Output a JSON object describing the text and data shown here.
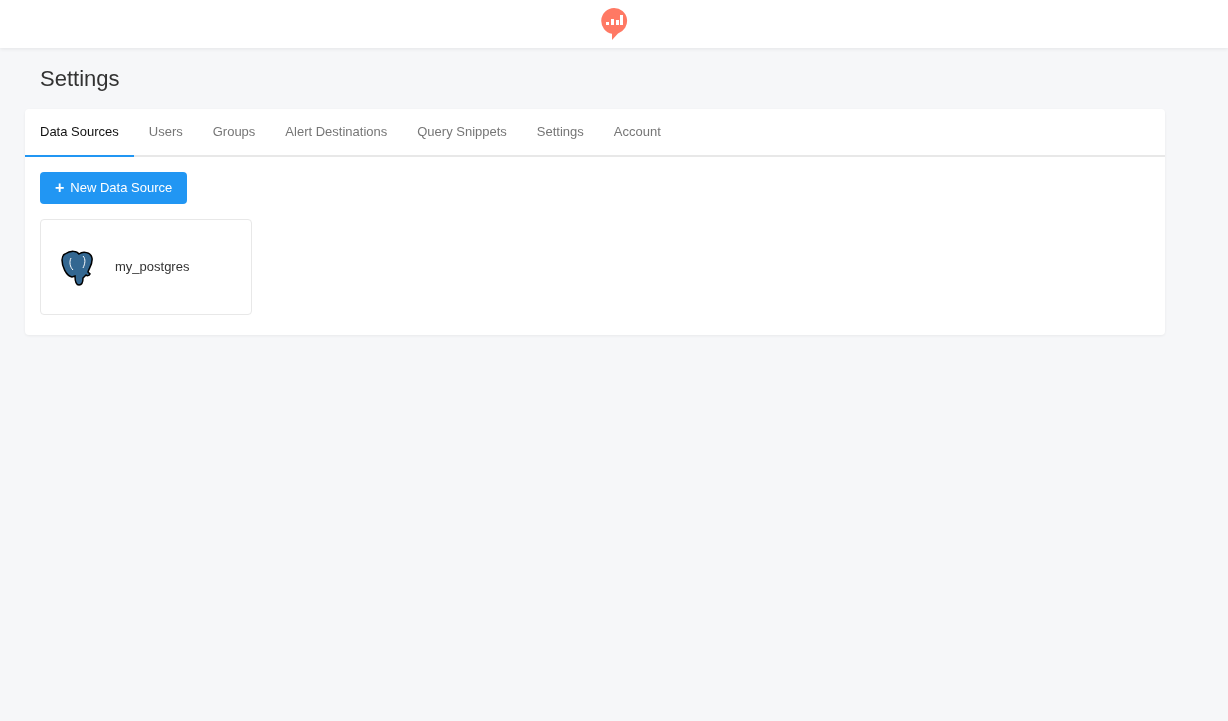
{
  "page_title": "Settings",
  "tabs": [
    {
      "label": "Data Sources",
      "selected": true
    },
    {
      "label": "Users",
      "selected": false
    },
    {
      "label": "Groups",
      "selected": false
    },
    {
      "label": "Alert Destinations",
      "selected": false
    },
    {
      "label": "Query Snippets",
      "selected": false
    },
    {
      "label": "Settings",
      "selected": false
    },
    {
      "label": "Account",
      "selected": false
    }
  ],
  "new_button": {
    "icon": "+",
    "label": "New Data Source"
  },
  "data_sources": [
    {
      "name": "my_postgres"
    }
  ]
}
